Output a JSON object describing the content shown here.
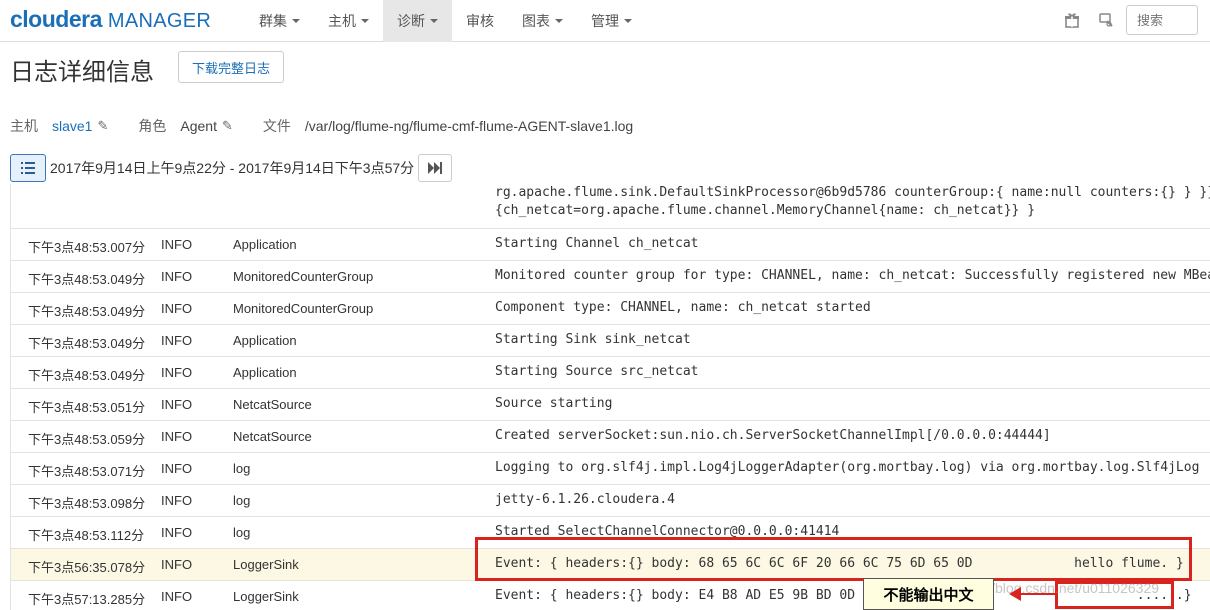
{
  "nav": {
    "brand": "cloudera",
    "product": "MANAGER",
    "items": [
      {
        "label": "群集",
        "caret": true,
        "active": false
      },
      {
        "label": "主机",
        "caret": true,
        "active": false
      },
      {
        "label": "诊断",
        "caret": true,
        "active": true
      },
      {
        "label": "审核",
        "caret": false,
        "active": false
      },
      {
        "label": "图表",
        "caret": true,
        "active": false
      },
      {
        "label": "管理",
        "caret": true,
        "active": false
      }
    ],
    "search_placeholder": "搜索"
  },
  "page": {
    "title": "日志详细信息",
    "download_label": "下载完整日志"
  },
  "meta": {
    "host_label": "主机",
    "host_value": "slave1",
    "role_label": "角色",
    "role_value": "Agent",
    "file_label": "文件",
    "file_value": "/var/log/flume-ng/flume-cmf-flume-AGENT-slave1.log"
  },
  "time_range": "2017年9月14日上午9点22分 - 2017年9月14日下午3点57分",
  "log": {
    "continuation": [
      "rg.apache.flume.sink.DefaultSinkProcessor@6b9d5786 counterGroup:{ name:null counters:{} } }}",
      "{ch_netcat=org.apache.flume.channel.MemoryChannel{name: ch_netcat}} }"
    ],
    "rows": [
      {
        "time": "下午3点48:53.007分",
        "level": "INFO",
        "source": "Application",
        "message": "Starting Channel ch_netcat"
      },
      {
        "time": "下午3点48:53.049分",
        "level": "INFO",
        "source": "MonitoredCounterGroup",
        "message": "Monitored counter group for type: CHANNEL, name: ch_netcat: Successfully registered new MBean."
      },
      {
        "time": "下午3点48:53.049分",
        "level": "INFO",
        "source": "MonitoredCounterGroup",
        "message": "Component type: CHANNEL, name: ch_netcat started"
      },
      {
        "time": "下午3点48:53.049分",
        "level": "INFO",
        "source": "Application",
        "message": "Starting Sink sink_netcat"
      },
      {
        "time": "下午3点48:53.049分",
        "level": "INFO",
        "source": "Application",
        "message": "Starting Source src_netcat"
      },
      {
        "time": "下午3点48:53.051分",
        "level": "INFO",
        "source": "NetcatSource",
        "message": "Source starting"
      },
      {
        "time": "下午3点48:53.059分",
        "level": "INFO",
        "source": "NetcatSource",
        "message": "Created serverSocket:sun.nio.ch.ServerSocketChannelImpl[/0.0.0.0:44444]"
      },
      {
        "time": "下午3点48:53.071分",
        "level": "INFO",
        "source": "log",
        "message": "Logging to org.slf4j.impl.Log4jLoggerAdapter(org.mortbay.log) via org.mortbay.log.Slf4jLog"
      },
      {
        "time": "下午3点48:53.098分",
        "level": "INFO",
        "source": "log",
        "message": "jetty-6.1.26.cloudera.4"
      },
      {
        "time": "下午3点48:53.112分",
        "level": "INFO",
        "source": "log",
        "message": "Started SelectChannelConnector@0.0.0.0:41414"
      },
      {
        "time": "下午3点56:35.078分",
        "level": "INFO",
        "source": "LoggerSink",
        "message": "Event: { headers:{} body: 68 65 6C 6C 6F 20 66 6C 75 6D 65 0D             hello flume. }"
      },
      {
        "time": "下午3点57:13.285分",
        "level": "INFO",
        "source": "LoggerSink",
        "message": "Event: { headers:{} body: E4 B8 AD E5 9B BD 0D                                    ......}"
      }
    ]
  },
  "annotation": {
    "callout_text": "不能输出中文",
    "watermark": "http://blog.csdn.net/u011026329"
  },
  "colors": {
    "brand": "#1a6fb8",
    "highlight_row": "#fcf8e3",
    "annotation_red": "#d9231e"
  }
}
